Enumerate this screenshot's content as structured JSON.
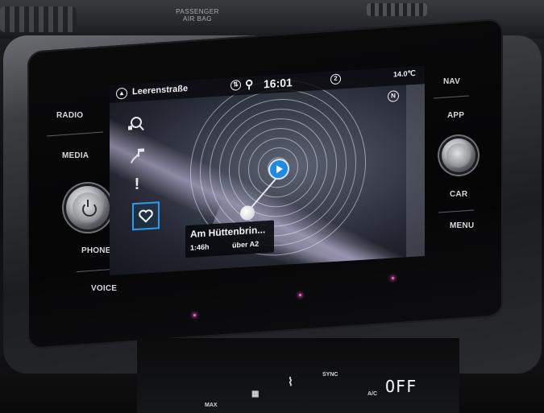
{
  "dashboard": {
    "airbag_label_line1": "PASSENGER",
    "airbag_label_line2": "AIR BAG"
  },
  "left_buttons": [
    "RADIO",
    "MEDIA",
    "PHONE",
    "VOICE"
  ],
  "right_buttons": [
    "NAV",
    "APP",
    "CAR",
    "MENU"
  ],
  "status_bar": {
    "street": "Leerenstraße",
    "time": "16:01",
    "temperature": "14.0℃",
    "badge_number": "2",
    "map_mode_letter": "N"
  },
  "sidebar": {
    "icons": [
      "search-destination-icon",
      "route-flag-icon",
      "info-exclamation-icon",
      "favorite-heart-icon"
    ],
    "selected": "favorite-heart-icon"
  },
  "destination_card": {
    "name": "Am Hüttenbrin...",
    "duration": "1:46h",
    "via": "über A2"
  },
  "climate": {
    "sync_label": "SYNC",
    "ac_label": "A/C",
    "max_label": "MAX",
    "fan_display": "OFF"
  },
  "colors": {
    "accent": "#2f9be8",
    "position_marker": "#1f8be0"
  }
}
